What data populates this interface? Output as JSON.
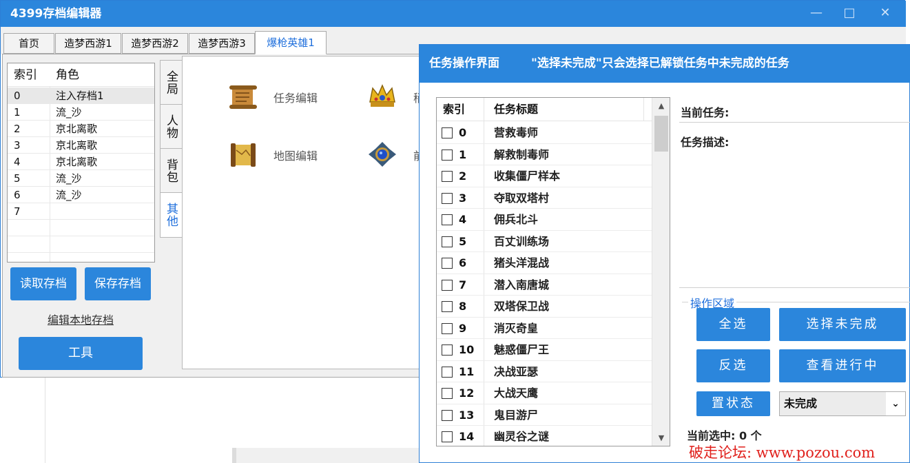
{
  "app": {
    "title": "4399存档编辑器",
    "window_controls": {
      "minimize": "—",
      "maximize": "□",
      "close": "✕"
    }
  },
  "tabs": [
    "首页",
    "造梦西游1",
    "造梦西游2",
    "造梦西游3",
    "爆枪英雄1"
  ],
  "active_tab": "爆枪英雄1",
  "role_grid": {
    "headers": {
      "index": "索引",
      "role": "角色"
    },
    "rows": [
      {
        "index": "0",
        "role": "注入存档1"
      },
      {
        "index": "1",
        "role": "流_沙"
      },
      {
        "index": "2",
        "role": "京北离歌"
      },
      {
        "index": "3",
        "role": "京北离歌"
      },
      {
        "index": "4",
        "role": "京北离歌"
      },
      {
        "index": "5",
        "role": "流_沙"
      },
      {
        "index": "6",
        "role": "流_沙"
      },
      {
        "index": "7",
        "role": ""
      }
    ]
  },
  "left_buttons": {
    "read": "读取存档",
    "save": "保存存档",
    "edit_local": "编辑本地存档",
    "tools": "工具"
  },
  "side_tabs": [
    "全局",
    "人物",
    "背包",
    "其他"
  ],
  "active_side_tab": "其他",
  "tools_panel": {
    "task_edit": "任务编辑",
    "map_edit": "地图编辑",
    "partial1": "稍",
    "partial2": "前"
  },
  "dialog": {
    "title": "任务操作界面",
    "hint": "\"选择未完成\"只会选择已解锁任务中未完成的任务",
    "list_headers": {
      "index": "索引",
      "title": "任务标题"
    },
    "tasks": [
      {
        "index": "0",
        "title": "营救毒师"
      },
      {
        "index": "1",
        "title": "解救制毒师"
      },
      {
        "index": "2",
        "title": "收集僵尸样本"
      },
      {
        "index": "3",
        "title": "夺取双塔村"
      },
      {
        "index": "4",
        "title": "佣兵北斗"
      },
      {
        "index": "5",
        "title": "百丈训练场"
      },
      {
        "index": "6",
        "title": "猪头洋混战"
      },
      {
        "index": "7",
        "title": "潜入南唐城"
      },
      {
        "index": "8",
        "title": "双塔保卫战"
      },
      {
        "index": "9",
        "title": "消灭奇皇"
      },
      {
        "index": "10",
        "title": "魅惑僵尸王"
      },
      {
        "index": "11",
        "title": "决战亚瑟"
      },
      {
        "index": "12",
        "title": "大战天鹰"
      },
      {
        "index": "13",
        "title": "鬼目游尸"
      },
      {
        "index": "14",
        "title": "幽灵谷之谜"
      }
    ],
    "current_task_label": "当前任务:",
    "task_desc_label": "任务描述:",
    "ops_group_label": "操作区域",
    "buttons": {
      "select_all": "全选",
      "select_incomplete": "选择未完成",
      "invert": "反选",
      "view_in_progress": "查看进行中",
      "set_state": "置状态"
    },
    "state_select_value": "未完成",
    "selected_count_text": "当前选中: 0 个"
  },
  "watermark": "破走论坛: www.pozou.com",
  "colors": {
    "accent": "#2b86dc",
    "tab_active_text": "#1f6fdc",
    "watermark": "#e0201c"
  }
}
